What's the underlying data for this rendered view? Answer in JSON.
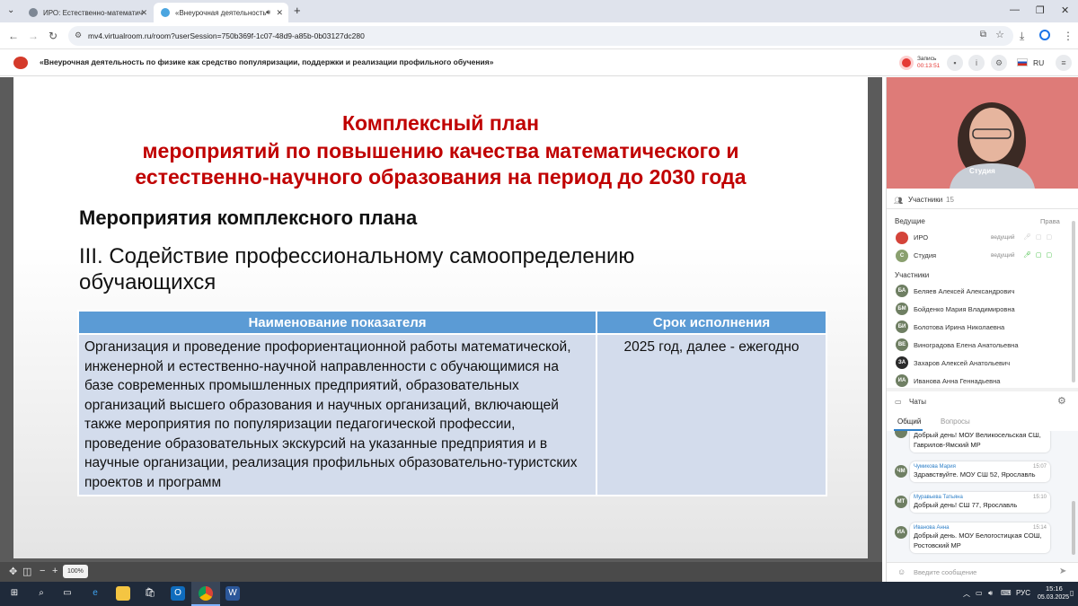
{
  "browser": {
    "tabs": [
      {
        "title": "ИРО: Естественно-математич",
        "active": false
      },
      {
        "title": "«Внеурочная деятельность",
        "active": true
      }
    ],
    "new_tab": "+",
    "url": "mv4.virtualroom.ru/room?userSession=750b369f-1c07-48d9-a85b-0b03127dc280"
  },
  "app": {
    "title": "«Внеурочная деятельность по физике как средство популяризации, поддержки и реализации профильного обучения»",
    "recording_label": "Запись",
    "recording_time": "00:13:51",
    "language": "RU"
  },
  "slide": {
    "title_lines": [
      "Комплексный план",
      "мероприятий по повышению качества математического и",
      "естественно-научного образования на период до 2030 года"
    ],
    "subtitle": "Мероприятия комплексного плана",
    "section_line1": "III. Содействие профессиональному самоопределению",
    "section_line2": "обучающихся",
    "table": {
      "headers": [
        "Наименование показателя",
        "Срок исполнения"
      ],
      "rows": [
        [
          "Организация и проведение профориентационной работы математической, инженерной и естественно-научной направленности с обучающимися на базе современных промышленных предприятий, образовательных организаций высшего образования и научных организаций, включающей также мероприятия по популяризации педагогической профессии, проведение образовательных экскурсий на указанные предприятия и в научные организации, реализация профильных образовательно-туристских проектов и программ",
          "2025 год, далее - ежегодно"
        ]
      ]
    }
  },
  "stage": {
    "zoom": "100%"
  },
  "video": {
    "label": "Студия"
  },
  "participants": {
    "header": "Участники",
    "count": "15",
    "hosts_label": "Ведущие",
    "rights_label": "Права",
    "hosts": [
      {
        "name": "ИРО",
        "role": "ведущий",
        "initials": ""
      },
      {
        "name": "Студия",
        "role": "ведущий",
        "initials": "С"
      }
    ],
    "members_label": "Участники",
    "members": [
      {
        "initials": "БА",
        "name": "Беляев Алексей Александрович"
      },
      {
        "initials": "БМ",
        "name": "Бойденко Мария Владимировна"
      },
      {
        "initials": "БИ",
        "name": "Болотова Ирина Николаевна"
      },
      {
        "initials": "ВЕ",
        "name": "Виноградова Елена Анатольевна"
      },
      {
        "initials": "ЗА",
        "name": "Захаров Алексей Анатольевич"
      },
      {
        "initials": "ИА",
        "name": "Иванова Анна Геннадьевна"
      }
    ]
  },
  "chats": {
    "header": "Чаты",
    "tab_general": "Общий",
    "tab_questions": "Вопросы",
    "messages": [
      {
        "initials": "",
        "author": "",
        "time": "",
        "text_line1": "Добрый день! МОУ Великосельская СШ,",
        "text_line2": "Гаврилов-Ямский МР"
      },
      {
        "initials": "ЧМ",
        "author": "Чумикова Мария",
        "time": "15:07",
        "text_line1": "Здравствуйте. МОУ СШ 52, Ярославль",
        "text_line2": ""
      },
      {
        "initials": "МТ",
        "author": "Муравьева Татьяна",
        "time": "15:10",
        "text_line1": "Добрый день! СШ 77, Ярославль",
        "text_line2": ""
      },
      {
        "initials": "ИА",
        "author": "Иванова Анна",
        "time": "15:14",
        "text_line1": "Добрый день. МОУ Белогостицкая СОШ,",
        "text_line2": "Ростовский МР"
      }
    ],
    "input_placeholder": "Введите сообщение"
  },
  "taskbar": {
    "language": "РУС",
    "time": "15:16",
    "date": "05.03.2025"
  },
  "colors": {
    "slide_title": "#c00000",
    "table_header": "#5b9bd5",
    "table_cell": "#d3dcec",
    "accent": "#2f80c8"
  }
}
